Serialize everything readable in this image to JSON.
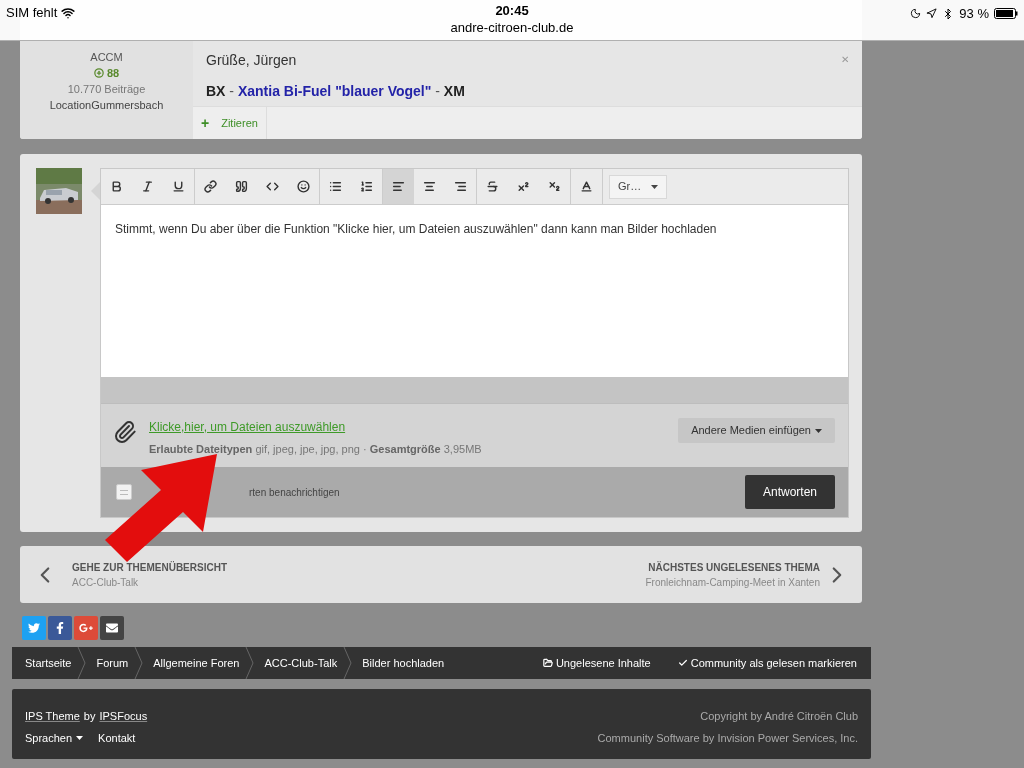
{
  "status_bar": {
    "carrier": "SIM fehlt",
    "time": "20:45",
    "url": "andre-citroen-club.de",
    "battery": "93 %"
  },
  "previous_post": {
    "author": {
      "group": "ACCM",
      "reputation": "88",
      "posts": "10.770 Beiträge",
      "location": "LocationGummersbach"
    },
    "greeting": "Grüße, Jürgen",
    "signature": [
      {
        "text": "BX",
        "kind": "plain"
      },
      {
        "text": " - ",
        "kind": "sep"
      },
      {
        "text": "Xantia Bi-Fuel \"blauer Vogel\"",
        "kind": "link"
      },
      {
        "text": " - ",
        "kind": "sep"
      },
      {
        "text": "XM",
        "kind": "plain"
      }
    ],
    "quote_icon": "+",
    "quote_button": "Zitieren",
    "close_icon": "✕"
  },
  "editor": {
    "toolbar": [
      [
        {
          "selected": false
        },
        {
          "selected": false
        },
        {
          "selected": false
        }
      ],
      [
        {
          "selected": false
        },
        {
          "selected": false
        },
        {
          "selected": false
        },
        {
          "selected": false
        }
      ],
      [
        {
          "selected": false
        },
        {
          "selected": false
        }
      ],
      [
        {
          "selected": true
        },
        {
          "selected": false
        },
        {
          "selected": false
        }
      ],
      [
        {
          "selected": false
        },
        {
          "selected": false
        },
        {
          "selected": false
        }
      ],
      [
        {
          "selected": false
        }
      ]
    ],
    "font_dropdown": "Gr…",
    "value": "Stimmt, wenn Du aber über die Funktion \"Klicke hier, um Dateien auszuwählen\" dann kann man Bilder hochladen",
    "attach_link": "Klicke,hier, um Dateien auszuwählen ",
    "allowed_label": "Erlaubte Dateitypen",
    "allowed_types": "gif, jpeg, jpe, jpg, png",
    "separator": "·",
    "size_label": "Gesamtgröße",
    "size_value": "3,95MB",
    "media_button": "Andere Medien einfügen",
    "notify": {
      "checked": false,
      "label": "rten benachrichtigen"
    },
    "submit": "Antworten"
  },
  "topic_nav": {
    "prev": {
      "title": "GEHE ZUR THEMENÜBERSICHT",
      "subtitle": "ACC-Club-Talk"
    },
    "next": {
      "title": "NÄCHSTES UNGELESENES THEMA",
      "subtitle": "Fronleichnam-Camping-Meet in Xanten"
    }
  },
  "breadcrumbs": [
    "Startseite",
    "Forum",
    "Allgemeine Foren",
    "ACC-Club-Talk",
    "Bilder hochladen"
  ],
  "breadcrumb_actions": [
    {
      "label": "Ungelesene Inhalte",
      "kind": "folder"
    },
    {
      "label": "Community als gelesen markieren",
      "kind": "check"
    }
  ],
  "footer": {
    "theme": "IPS Theme",
    "by": "by",
    "focus": "IPSFocus",
    "language": "Sprachen",
    "contact": "Kontakt",
    "copyright": "Copyright by André Citroën Club",
    "software": "Community Software by Invision Power Services, Inc."
  }
}
